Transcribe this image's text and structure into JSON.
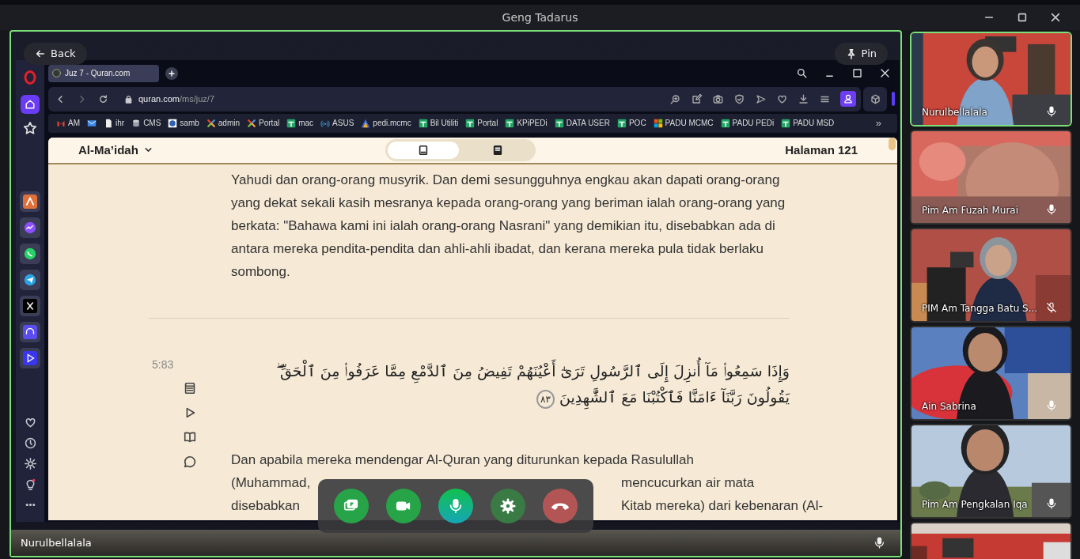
{
  "window": {
    "title": "Geng Tadarus"
  },
  "stage": {
    "back": "Back",
    "pin": "Pin",
    "presenter": "Nurulbellalala",
    "presenter_muted": false
  },
  "browser": {
    "tab": {
      "title": "Juz 7 - Quran.com"
    },
    "url": {
      "host": "quran.com",
      "path": "/ms/juz/7"
    },
    "bookmarks": [
      {
        "kind": "gmail",
        "label": "AM"
      },
      {
        "kind": "mail"
      },
      {
        "kind": "page",
        "label": "ihr"
      },
      {
        "kind": "cms",
        "label": "CMS"
      },
      {
        "kind": "samb",
        "label": "samb"
      },
      {
        "kind": "joomla",
        "label": "admin"
      },
      {
        "kind": "joomla",
        "label": "Portal"
      },
      {
        "kind": "sheet",
        "label": "mac"
      },
      {
        "kind": "signal",
        "label": "ASUS"
      },
      {
        "kind": "triangle",
        "label": "pedi.mcmc"
      },
      {
        "kind": "sheet",
        "label": "Bil Utiliti"
      },
      {
        "kind": "sheet",
        "label": "Portal"
      },
      {
        "kind": "sheet",
        "label": "KPiPEDi"
      },
      {
        "kind": "sheet",
        "label": "DATA USER"
      },
      {
        "kind": "sheet",
        "label": "POC"
      },
      {
        "kind": "tiles",
        "label": "PADU MCMC"
      },
      {
        "kind": "sheet",
        "label": "PADU PEDi"
      },
      {
        "kind": "sheet",
        "label": "PADU MSD"
      }
    ],
    "more": "»"
  },
  "reader": {
    "surah": "Al-Ma’idah",
    "view_modes": [
      {
        "kind": "book",
        "selected": true
      },
      {
        "kind": "page",
        "selected": false
      }
    ],
    "page": "Halaman 121",
    "paragraph": "Yahudi dan orang-orang musyrik. Dan demi sesungguhnya engkau akan dapati orang-orang yang dekat sekali kasih mesranya kepada orang-orang yang beriman ialah orang-orang yang berkata: \"Bahawa kami ini ialah orang-orang Nasrani\" yang demikian itu, disebabkan ada di antara mereka pendita-pendita dan ahli-ahli ibadat, dan kerana mereka pula tidak berlaku sombong.",
    "verse": {
      "key": "5:83",
      "arabic": "وَإِذَا سَمِعُوا۟ مَآ أُنزِلَ إِلَى ٱلرَّسُولِ تَرَىٰٓ أَعْيُنَهُمْ تَفِيضُ مِنَ ٱلدَّمْعِ مِمَّا عَرَفُوا۟ مِنَ ٱلْحَقِّ ۖ يَقُولُونَ رَبَّنَآ ءَامَنَّا فَٱكْتُبْنَا مَعَ ٱلشَّٰهِدِينَ",
      "number": "٨٣"
    },
    "translation_lines": [
      {
        "parts": [
          "Dan apabila mereka mendengar Al-Quran yang diturunkan kepada Rasulullah"
        ]
      },
      {
        "parts": [
          "(Muhammad,",
          "mencucurkan air mata"
        ]
      },
      {
        "parts": [
          "disebabkan",
          "Kitab mereka) dari kebenaran (Al-"
        ]
      }
    ]
  },
  "controls": [
    {
      "kind": "share"
    },
    {
      "kind": "camera"
    },
    {
      "kind": "mic"
    },
    {
      "kind": "settings"
    },
    {
      "kind": "hangup"
    }
  ],
  "participants": [
    {
      "name": "Nurulbellalala",
      "muted": false,
      "speaking": true
    },
    {
      "name": "Pim Am Fuzah Murai",
      "muted": false,
      "speaking": false
    },
    {
      "name": "PIM Am Tangga Batu S...",
      "muted": true,
      "speaking": false
    },
    {
      "name": "Ain Sabrina",
      "muted": false,
      "speaking": false
    },
    {
      "name": "Pim Am Pengkalan Iqa",
      "muted": false,
      "speaking": false
    }
  ]
}
